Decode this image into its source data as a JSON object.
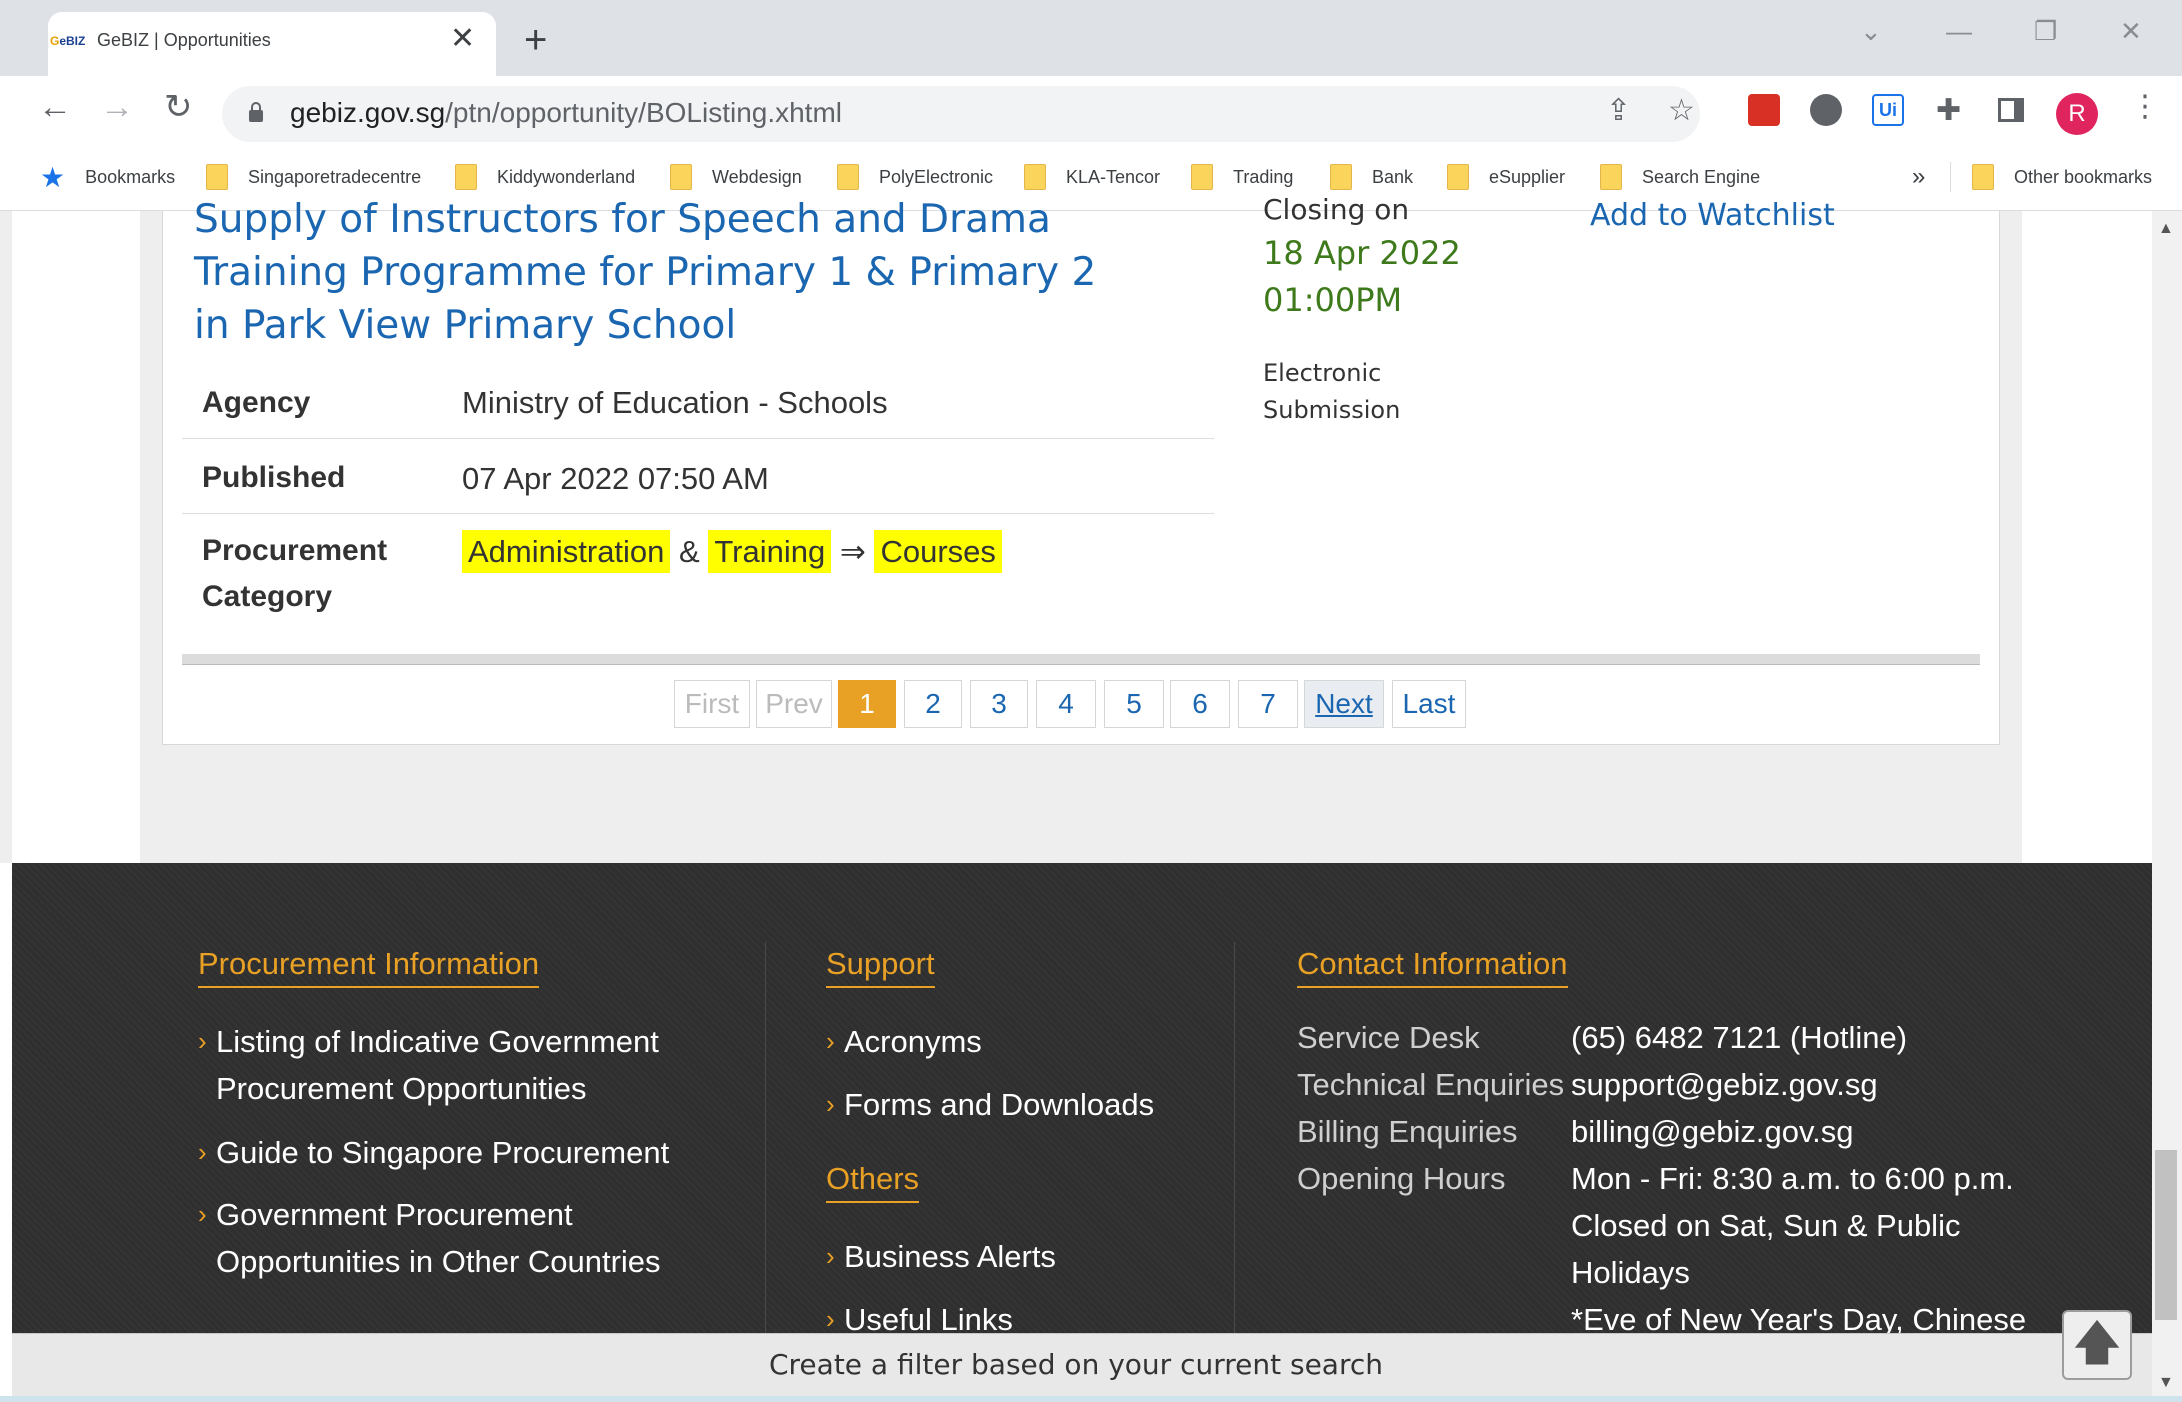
{
  "browser": {
    "tab_title": "GeBIZ | Opportunities",
    "favicon_text": "GeBIZ",
    "url_host": "gebiz.gov.sg",
    "url_path": "/ptn/opportunity/BOListing.xhtml",
    "avatar_letter": "R",
    "bookmarks": [
      {
        "label": "Bookmarks",
        "icon": "star-icon"
      },
      {
        "label": "Singaporetradecentre",
        "icon": "folder-icon"
      },
      {
        "label": "Kiddywonderland",
        "icon": "folder-icon"
      },
      {
        "label": "Webdesign",
        "icon": "folder-icon"
      },
      {
        "label": "PolyElectronic",
        "icon": "folder-icon"
      },
      {
        "label": "KLA-Tencor",
        "icon": "folder-icon"
      },
      {
        "label": "Trading",
        "icon": "folder-icon"
      },
      {
        "label": "Bank",
        "icon": "folder-icon"
      },
      {
        "label": "eSupplier",
        "icon": "folder-icon"
      },
      {
        "label": "Search Engine",
        "icon": "folder-icon"
      }
    ],
    "other_bookmarks": "Other bookmarks",
    "overflow_chevron": "»"
  },
  "opportunity": {
    "title": "Supply of Instructors for Speech and Drama Training Programme for Primary 1 & Primary 2 in Park View Primary School",
    "closing_label": "Closing on",
    "closing_date": "18 Apr 2022",
    "closing_time": "01:00PM",
    "submission_line1": "Electronic",
    "submission_line2": "Submission",
    "watchlist_label": "Add to Watchlist",
    "agency_label": "Agency",
    "agency_value": "Ministry of Education - Schools",
    "published_label": "Published",
    "published_value": "07 Apr 2022 07:50 AM",
    "category_label_1": "Procurement",
    "category_label_2": "Category",
    "category": {
      "part1": "Administration",
      "amp": "&",
      "part2": "Training",
      "arrow": "⇒",
      "part3": "Courses"
    }
  },
  "pagination": {
    "first": "First",
    "prev": "Prev",
    "pages": [
      "1",
      "2",
      "3",
      "4",
      "5",
      "6",
      "7"
    ],
    "current": "1",
    "next": "Next",
    "last": "Last"
  },
  "footer": {
    "procurement_heading": "Procurement Information",
    "procurement_links": [
      {
        "line1": "Listing of Indicative Government",
        "line2": "Procurement Opportunities"
      },
      {
        "line1": "Guide to Singapore Procurement",
        "line2": ""
      },
      {
        "line1": "Government Procurement",
        "line2": "Opportunities in Other Countries"
      }
    ],
    "support_heading": "Support",
    "support_links": [
      "Acronyms",
      "Forms and Downloads"
    ],
    "others_heading": "Others",
    "others_links": [
      "Business Alerts",
      "Useful Links"
    ],
    "contact_heading": "Contact Information",
    "contact": [
      {
        "label": "Service Desk",
        "value": "(65) 6482 7121 (Hotline)"
      },
      {
        "label": "Technical Enquiries",
        "value": "support@gebiz.gov.sg"
      },
      {
        "label": "Billing Enquiries",
        "value": "billing@gebiz.gov.sg"
      },
      {
        "label": "Opening Hours",
        "value": "Mon - Fri: 8:30 a.m. to 6:00 p.m."
      }
    ],
    "hours_extra_1": "Closed on Sat, Sun & Public",
    "hours_extra_2": "Holidays",
    "hours_extra_3": "*Eve of New Year's Day, Chinese"
  },
  "filter_bar": {
    "text": "Create a filter based on your current search"
  },
  "colors": {
    "link_blue": "#1a66b1",
    "accent_orange": "#e8a025",
    "closing_green": "#3e7a1c",
    "highlight_yellow": "#ffff00",
    "footer_bg": "#2f2f2f"
  }
}
